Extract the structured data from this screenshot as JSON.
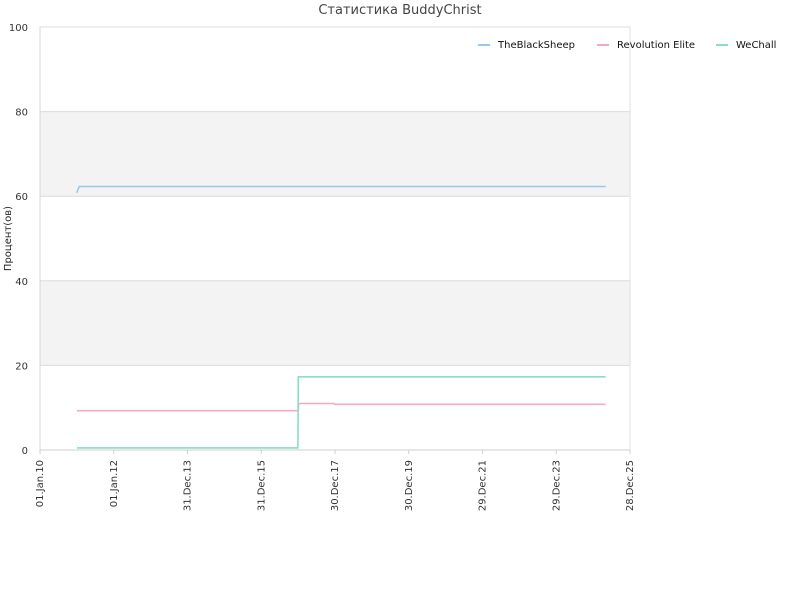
{
  "chart_data": {
    "type": "line",
    "title": "Статистика BuddyChrist",
    "xlabel": "",
    "ylabel": "Процент(ов)",
    "ylim": [
      0,
      100
    ],
    "xlim": [
      "2010-01-01",
      "2025-12-28"
    ],
    "yticks": [
      "0",
      "20",
      "40",
      "60",
      "80",
      "100"
    ],
    "xticks": [
      {
        "label": "01.Jan.10",
        "date": "2010-01-01"
      },
      {
        "label": "01.Jan.12",
        "date": "2012-01-01"
      },
      {
        "label": "31.Dec.13",
        "date": "2013-12-31"
      },
      {
        "label": "31.Dec.15",
        "date": "2015-12-31"
      },
      {
        "label": "30.Dec.17",
        "date": "2017-12-30"
      },
      {
        "label": "30.Dec.19",
        "date": "2019-12-30"
      },
      {
        "label": "29.Dec.21",
        "date": "2021-12-29"
      },
      {
        "label": "29.Dec.23",
        "date": "2023-12-29"
      },
      {
        "label": "28.Dec.25",
        "date": "2025-12-28"
      }
    ],
    "legend_position": "top-right",
    "band_fill": "#f3f3f3",
    "series": [
      {
        "name": "TheBlackSheep",
        "color": "#9ac8ea",
        "points": [
          {
            "x": "2011-01-01",
            "y": 60.8
          },
          {
            "x": "2011-01-10",
            "y": 61.5
          },
          {
            "x": "2011-01-25",
            "y": 62.3
          },
          {
            "x": "2025-05-01",
            "y": 62.3
          }
        ]
      },
      {
        "name": "Revolution Elite",
        "color": "#f2aac8",
        "points": [
          {
            "x": "2011-01-01",
            "y": 9.3
          },
          {
            "x": "2017-01-01",
            "y": 9.3
          },
          {
            "x": "2017-01-05",
            "y": 11.0
          },
          {
            "x": "2017-12-20",
            "y": 11.0
          },
          {
            "x": "2017-12-25",
            "y": 10.8
          },
          {
            "x": "2025-05-01",
            "y": 10.8
          }
        ]
      },
      {
        "name": "WeChall",
        "color": "#88e0c0",
        "points": [
          {
            "x": "2011-01-01",
            "y": 0.5
          },
          {
            "x": "2016-12-28",
            "y": 0.5
          },
          {
            "x": "2017-01-01",
            "y": 17.3
          },
          {
            "x": "2025-05-01",
            "y": 17.3
          }
        ]
      }
    ]
  }
}
